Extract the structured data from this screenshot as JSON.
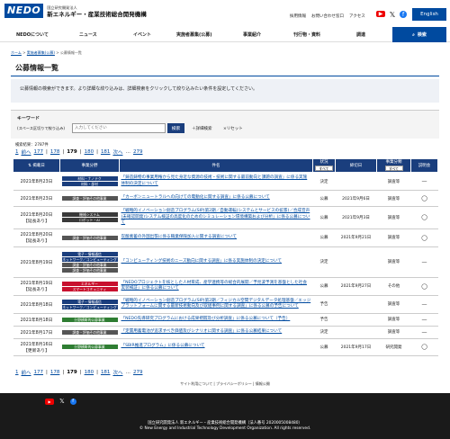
{
  "header": {
    "logo": "NEDO",
    "org_small": "国立研究開発法人",
    "org_name": "新エネルギー・産業技術総合開発機構",
    "links": [
      "採用情報",
      "お問い合わせ窓口",
      "アクセス"
    ],
    "english_button": "English",
    "icons": [
      "youtube-icon",
      "x-icon",
      "facebook-icon"
    ]
  },
  "nav": {
    "items": [
      "NEDOについて",
      "ニュース",
      "イベント",
      "実施者募集(公募)",
      "事業紹介",
      "刊行物・資料",
      "調達"
    ],
    "search_label": "検索"
  },
  "breadcrumb": [
    "ホーム",
    "実施者募集(公募)",
    "公募情報一覧"
  ],
  "page_title": "公募情報一覧",
  "intro": "公募情報の検索ができます。より詳細な絞り込みは、詳細検索をクリックして絞り込みたい条件を設定してください。",
  "keyword": {
    "label": "キーワード",
    "sub": "(スペース区切りで絞り込み)",
    "placeholder": "入力してください",
    "search_button": "検索",
    "detail_label": "詳細検索",
    "reset_label": "リセット"
  },
  "result_count": "検索結果：2787件",
  "pager": {
    "first": "1",
    "prev": "前へ",
    "pages": [
      "177",
      "178",
      "179",
      "180",
      "181"
    ],
    "current": "179",
    "next": "次へ",
    "last": "279"
  },
  "table": {
    "headers": {
      "date": "掲載日",
      "category": "事業分野",
      "subject": "件名",
      "status": "状況",
      "status_select": "すべて",
      "deadline": "締切日",
      "type": "事業分類",
      "type_select": "すべて",
      "doc": "説明会"
    },
    "rows": [
      {
        "date": "2021年8月23日",
        "note": "",
        "tags": [
          [
            "b",
            "材料・ナノテク"
          ],
          [
            "b",
            "材料・部材"
          ]
        ],
        "subject": "「鋳造鋳物の事業用権から見た身近な資源の技術・技術に関する最前動向と課題の調査」に係る実施体制の決定について",
        "status": "決定",
        "deadline": "",
        "type": "調査等",
        "doc": "—"
      },
      {
        "date": "2021年8月23日",
        "note": "",
        "tags": [
          [
            "g",
            "調査・評価その他事業"
          ]
        ],
        "subject": "「カーボンニュートラルへの向けての電動化に関する調査」に係る公募について",
        "status": "公募",
        "deadline": "2021年9月6日",
        "type": "調査等",
        "doc": "◯"
      },
      {
        "date": "2021年8月20日",
        "note": "【延長あり】",
        "tags": [
          [
            "n",
            "機械システム"
          ],
          [
            "n",
            "ロボット・AI"
          ]
        ],
        "subject": "「戦略的イノベーション創造プログラム(SIP)第2期／自動運転(システムとサービスの拡張)／合成音声(未確認開発)システム検証の高度化のためのシミュレーション環境構築および分析」に係る公募について",
        "status": "公募",
        "deadline": "2021年9月3日",
        "type": "調査等",
        "doc": "◯"
      },
      {
        "date": "2021年8月20日",
        "note": "【延長あり】",
        "tags": [
          [
            "g",
            "調査・評価その他事業"
          ]
        ],
        "subject": "炭酸素蓄の外国出張に係る職業保険加入に関する調査について",
        "status": "公募",
        "deadline": "2021年9月21日",
        "type": "調査等",
        "doc": "◯"
      },
      {
        "date": "2021年8月19日",
        "note": "",
        "tags": [
          [
            "b",
            "電子・情報通信"
          ],
          [
            "b",
            "ネットワーク／コンピューティング"
          ],
          [
            "g",
            "調査・評価その他事業"
          ],
          [
            "g",
            "調査・評価その他事業"
          ]
        ],
        "subject": "「コンピューティング技術のニーズ動向に関する調査」に係る実施体制の決定について",
        "status": "決定",
        "deadline": "",
        "type": "調査等",
        "doc": "—"
      },
      {
        "date": "2021年8月19日",
        "note": "【延長あり】",
        "tags": [
          [
            "r",
            "エネルギー"
          ],
          [
            "r",
            "スマートコミュニティ"
          ]
        ],
        "subject": "「NEDOプロジェクトを核とした人材育成、産学連携等の総合的展開／予見波予測を基盤とした社会実装検証」に係る公募について",
        "status": "公募",
        "deadline": "2021年9月27日",
        "type": "その他",
        "doc": "◯"
      },
      {
        "date": "2021年8月18日",
        "note": "",
        "tags": [
          [
            "b",
            "電子・情報通信"
          ],
          [
            "b",
            "ネットワーク／コンピューティング"
          ]
        ],
        "subject": "「戦略的イノベーション創造プログラム(SIP)第2期／フィジカル空間デジタルデータ処理基盤／エッジプラットフォームに関する最新技術動向及び取組事例に関する調査」に係る公募の予告について",
        "status": "予告",
        "deadline": "",
        "type": "調査等",
        "doc": "—"
      },
      {
        "date": "2021年8月18日",
        "note": "",
        "tags": [
          [
            "gr",
            "分野横断的公募事業"
          ]
        ],
        "subject": "「NEDO先導研究プログラムにおける成果把握及び分析調査」に係る公募について（予告）",
        "status": "予告",
        "deadline": "",
        "type": "調査等",
        "doc": "—"
      },
      {
        "date": "2021年8月17日",
        "note": "",
        "tags": [
          [
            "g",
            "調査・評価その他事業"
          ]
        ],
        "subject": "「定置用蓄電池が追求すべき価値及びシナリオに関する調査」に係る公募結果について",
        "status": "決定",
        "deadline": "",
        "type": "調査等",
        "doc": "—"
      },
      {
        "date": "2021年8月16日",
        "note": "【更新あり】",
        "tags": [
          [
            "gr",
            "分野横断的公募事業"
          ]
        ],
        "subject": "「SBIR推進プログラム」に係る公募について",
        "status": "公募",
        "deadline": "2021年9月17日",
        "type": "研究開発",
        "doc": "◯"
      }
    ]
  },
  "footer": {
    "links": [
      "サイト利用について",
      "プライバシーポリシー",
      "情報公開"
    ],
    "org_line": "国立研究開発法人 新エネルギー・産業技術総合開発機構（法人番号 2020005008480）",
    "copyright": "© New Energy and Industrial Technology Development Organization. All rights reserved."
  }
}
